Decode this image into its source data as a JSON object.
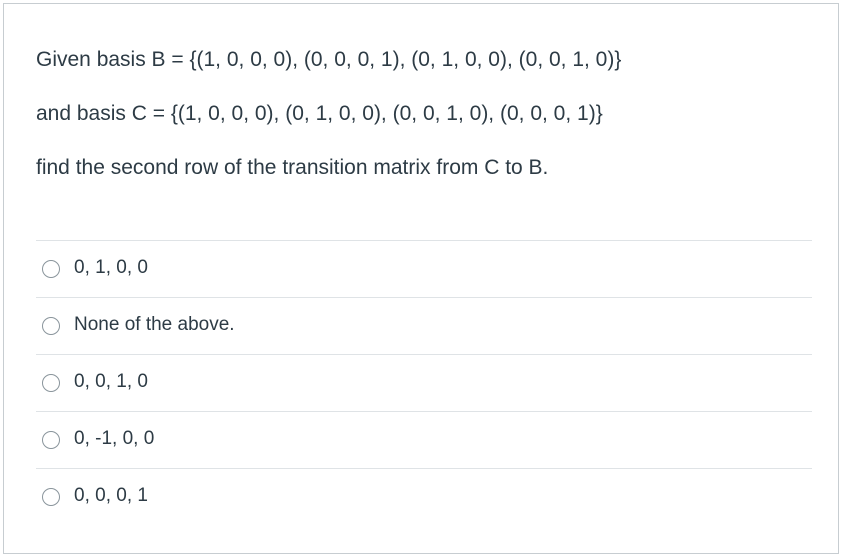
{
  "question": {
    "line1": "Given basis B = {(1, 0, 0, 0), (0, 0, 0, 1), (0, 1, 0, 0), (0, 0, 1, 0)}",
    "line2": "and basis C = {(1, 0, 0, 0), (0, 1, 0, 0), (0, 0, 1, 0), (0, 0, 0, 1)}",
    "line3": "find the second row of the transition matrix from C to B."
  },
  "answers": [
    {
      "label": "0, 1, 0, 0",
      "selected": false
    },
    {
      "label": "None of the above.",
      "selected": false
    },
    {
      "label": "0, 0, 1, 0",
      "selected": false
    },
    {
      "label": "0, -1, 0, 0",
      "selected": false
    },
    {
      "label": "0, 0, 0, 1",
      "selected": false
    }
  ],
  "colors": {
    "text": "#2d3b45",
    "border": "#c7cdd1",
    "divider": "#dfe3e6",
    "radio_border": "#8a959c"
  }
}
